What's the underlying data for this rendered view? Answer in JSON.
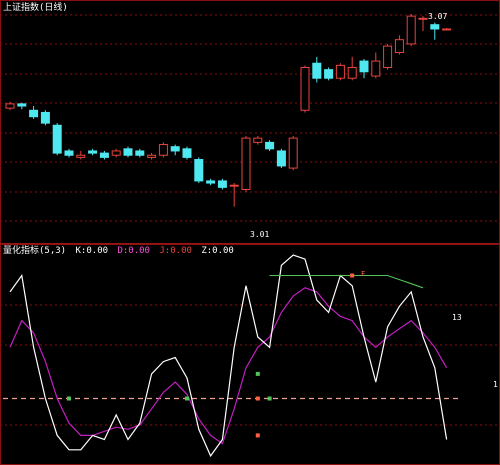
{
  "top_panel": {
    "title": "上证指数(日线)",
    "title_color": "#ffffff",
    "high_label": "3.07",
    "low_label": "3.01",
    "up_color": "#e8433c",
    "down_color": "#4fe8f0",
    "grid_color": "#8a1010"
  },
  "bottom_panel": {
    "title": "量化指标(5,3)",
    "indicators": [
      {
        "text": "K:0.00",
        "color": "#ffffff"
      },
      {
        "text": "D:0.00",
        "color": "#ff4fd8"
      },
      {
        "text": "J:0.00",
        "color": "#e8433c"
      },
      {
        "text": "Z:0.00",
        "color": "#ffffff"
      }
    ],
    "right_label": "13",
    "axis_label": "1",
    "signal_label": "F",
    "colors": {
      "white_line": "#ffffff",
      "magenta_line": "#c21fc2",
      "green_line": "#52c25a",
      "dashed_line": "#f0a090"
    }
  },
  "chart_data": {
    "type": "candlestick",
    "series": [
      {
        "name": "candles",
        "values": [
          {
            "o": 0.56,
            "c": 0.58,
            "h": 0.59,
            "l": 0.55
          },
          {
            "o": 0.58,
            "c": 0.57,
            "h": 0.585,
            "l": 0.555
          },
          {
            "o": 0.55,
            "c": 0.52,
            "h": 0.57,
            "l": 0.51
          },
          {
            "o": 0.54,
            "c": 0.49,
            "h": 0.55,
            "l": 0.48
          },
          {
            "o": 0.48,
            "c": 0.35,
            "h": 0.49,
            "l": 0.34
          },
          {
            "o": 0.36,
            "c": 0.34,
            "h": 0.37,
            "l": 0.33
          },
          {
            "o": 0.33,
            "c": 0.34,
            "h": 0.36,
            "l": 0.32
          },
          {
            "o": 0.36,
            "c": 0.35,
            "h": 0.37,
            "l": 0.34
          },
          {
            "o": 0.35,
            "c": 0.33,
            "h": 0.36,
            "l": 0.32
          },
          {
            "o": 0.34,
            "c": 0.36,
            "h": 0.37,
            "l": 0.33
          },
          {
            "o": 0.37,
            "c": 0.34,
            "h": 0.38,
            "l": 0.33
          },
          {
            "o": 0.36,
            "c": 0.34,
            "h": 0.37,
            "l": 0.33
          },
          {
            "o": 0.33,
            "c": 0.34,
            "h": 0.35,
            "l": 0.32
          },
          {
            "o": 0.34,
            "c": 0.39,
            "h": 0.4,
            "l": 0.33
          },
          {
            "o": 0.38,
            "c": 0.36,
            "h": 0.39,
            "l": 0.34
          },
          {
            "o": 0.37,
            "c": 0.33,
            "h": 0.38,
            "l": 0.32
          },
          {
            "o": 0.32,
            "c": 0.22,
            "h": 0.33,
            "l": 0.21
          },
          {
            "o": 0.22,
            "c": 0.21,
            "h": 0.23,
            "l": 0.2
          },
          {
            "o": 0.22,
            "c": 0.19,
            "h": 0.23,
            "l": 0.18
          },
          {
            "o": 0.2,
            "c": 0.2,
            "h": 0.21,
            "l": 0.1
          },
          {
            "o": 0.18,
            "c": 0.42,
            "h": 0.43,
            "l": 0.17
          },
          {
            "o": 0.4,
            "c": 0.42,
            "h": 0.43,
            "l": 0.39
          },
          {
            "o": 0.4,
            "c": 0.37,
            "h": 0.41,
            "l": 0.36
          },
          {
            "o": 0.36,
            "c": 0.29,
            "h": 0.37,
            "l": 0.28
          },
          {
            "o": 0.28,
            "c": 0.42,
            "h": 0.43,
            "l": 0.27
          },
          {
            "o": 0.55,
            "c": 0.75,
            "h": 0.76,
            "l": 0.54
          },
          {
            "o": 0.77,
            "c": 0.7,
            "h": 0.8,
            "l": 0.68
          },
          {
            "o": 0.74,
            "c": 0.7,
            "h": 0.75,
            "l": 0.69
          },
          {
            "o": 0.7,
            "c": 0.76,
            "h": 0.77,
            "l": 0.69
          },
          {
            "o": 0.7,
            "c": 0.75,
            "h": 0.8,
            "l": 0.69
          },
          {
            "o": 0.78,
            "c": 0.73,
            "h": 0.79,
            "l": 0.7
          },
          {
            "o": 0.71,
            "c": 0.78,
            "h": 0.82,
            "l": 0.7
          },
          {
            "o": 0.75,
            "c": 0.85,
            "h": 0.86,
            "l": 0.74
          },
          {
            "o": 0.82,
            "c": 0.88,
            "h": 0.9,
            "l": 0.81
          },
          {
            "o": 0.86,
            "c": 0.99,
            "h": 1.0,
            "l": 0.85
          },
          {
            "o": 0.98,
            "c": 0.98,
            "h": 0.99,
            "l": 0.92
          },
          {
            "o": 0.95,
            "c": 0.93,
            "h": 0.96,
            "l": 0.88
          },
          {
            "o": 0.93,
            "c": 0.93,
            "h": 0.935,
            "l": 0.925
          }
        ]
      },
      {
        "name": "K",
        "values": [
          0.82,
          0.9,
          0.55,
          0.3,
          0.12,
          0.05,
          0.05,
          0.12,
          0.1,
          0.22,
          0.1,
          0.18,
          0.42,
          0.48,
          0.5,
          0.4,
          0.15,
          0.02,
          0.1,
          0.55,
          0.85,
          0.6,
          0.55,
          0.95,
          1.0,
          0.98,
          0.78,
          0.72,
          0.9,
          0.85,
          0.6,
          0.38,
          0.65,
          0.75,
          0.82,
          0.6,
          0.45,
          0.1
        ]
      },
      {
        "name": "D",
        "values": [
          0.55,
          0.68,
          0.62,
          0.48,
          0.3,
          0.18,
          0.12,
          0.12,
          0.14,
          0.16,
          0.15,
          0.17,
          0.25,
          0.33,
          0.38,
          0.32,
          0.2,
          0.12,
          0.08,
          0.25,
          0.45,
          0.55,
          0.6,
          0.72,
          0.8,
          0.84,
          0.82,
          0.75,
          0.7,
          0.68,
          0.6,
          0.55,
          0.6,
          0.64,
          0.68,
          0.62,
          0.55,
          0.45
        ]
      },
      {
        "name": "green",
        "values": [
          0.9,
          0.9,
          0.9,
          0.9,
          0.9,
          0.9,
          0.9,
          0.9,
          0.9,
          0.9,
          0.9,
          0.88,
          0.86,
          0.84
        ]
      }
    ],
    "dashed_level": 0.3
  }
}
